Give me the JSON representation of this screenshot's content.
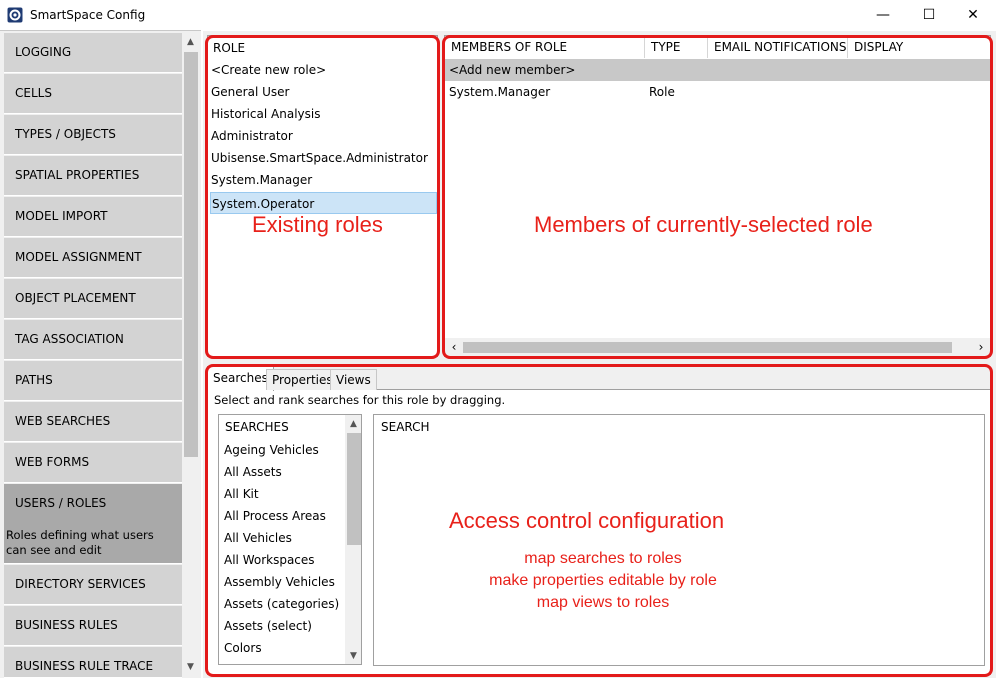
{
  "window": {
    "title": "SmartSpace Config",
    "minimize": "—",
    "maximize": "☐",
    "close": "✕"
  },
  "sidebar": {
    "items": [
      {
        "label": "LOGGING"
      },
      {
        "label": "CELLS"
      },
      {
        "label": "TYPES / OBJECTS"
      },
      {
        "label": "SPATIAL PROPERTIES"
      },
      {
        "label": "MODEL IMPORT"
      },
      {
        "label": "MODEL ASSIGNMENT"
      },
      {
        "label": "OBJECT PLACEMENT"
      },
      {
        "label": "TAG ASSOCIATION"
      },
      {
        "label": "PATHS"
      },
      {
        "label": "WEB SEARCHES"
      },
      {
        "label": "WEB FORMS"
      },
      {
        "label": "USERS / ROLES",
        "description": "Roles defining what users can see and edit"
      },
      {
        "label": "DIRECTORY SERVICES"
      },
      {
        "label": "BUSINESS RULES"
      },
      {
        "label": "BUSINESS RULE TRACE"
      }
    ]
  },
  "roles": {
    "header": "ROLE",
    "items": [
      "<Create new role>",
      "General User",
      "Historical Analysis",
      "Administrator",
      "Ubisense.SmartSpace.Administrator",
      "System.Manager",
      "System.Operator"
    ],
    "selected": "System.Operator"
  },
  "members": {
    "columns": [
      "MEMBERS OF ROLE",
      "TYPE",
      "EMAIL NOTIFICATIONS",
      "DISPLAY NOTIFICATIONS"
    ],
    "add_row": "<Add new member>",
    "rows": [
      {
        "member": "System.Manager",
        "type": "Role"
      }
    ]
  },
  "config": {
    "tabs": [
      "Searches",
      "Properties",
      "Views"
    ],
    "active_tab": "Searches",
    "instructions": "Select and rank searches for this role by dragging.",
    "searches_header": "SEARCHES",
    "searches": [
      "Ageing Vehicles",
      "All Assets",
      "All Kit",
      "All Process Areas",
      "All Vehicles",
      "All Workspaces",
      "Assembly Vehicles",
      "Assets (categories)",
      "Assets (select)",
      "Colors"
    ],
    "search_header": "SEARCH"
  },
  "annotations": {
    "roles": "Existing roles",
    "members": "Members of currently-selected role",
    "access_title": "Access control configuration",
    "access_lines": [
      "map searches to roles",
      "make properties editable by role",
      "map views to roles"
    ]
  },
  "colors": {
    "annotation": "#e31a1a",
    "selected_row": "#cce4f7",
    "sidebar_item": "#d3d3d3",
    "sidebar_selected": "#a9a9a9"
  }
}
